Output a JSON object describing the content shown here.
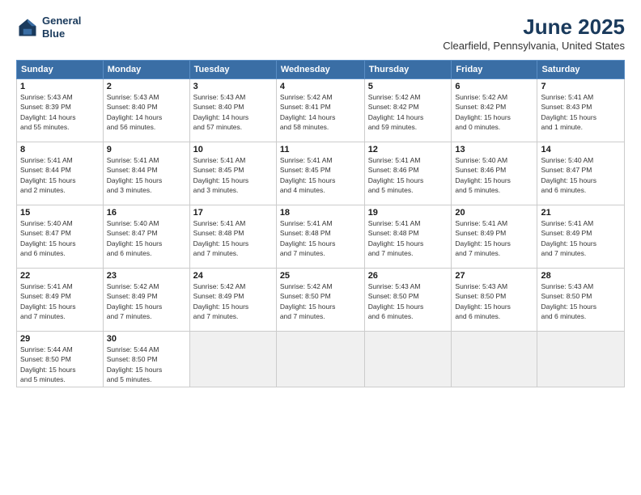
{
  "header": {
    "logo_line1": "General",
    "logo_line2": "Blue",
    "title": "June 2025",
    "subtitle": "Clearfield, Pennsylvania, United States"
  },
  "calendar": {
    "columns": [
      "Sunday",
      "Monday",
      "Tuesday",
      "Wednesday",
      "Thursday",
      "Friday",
      "Saturday"
    ],
    "weeks": [
      [
        {
          "day": "1",
          "info": "Sunrise: 5:43 AM\nSunset: 8:39 PM\nDaylight: 14 hours\nand 55 minutes."
        },
        {
          "day": "2",
          "info": "Sunrise: 5:43 AM\nSunset: 8:40 PM\nDaylight: 14 hours\nand 56 minutes."
        },
        {
          "day": "3",
          "info": "Sunrise: 5:43 AM\nSunset: 8:40 PM\nDaylight: 14 hours\nand 57 minutes."
        },
        {
          "day": "4",
          "info": "Sunrise: 5:42 AM\nSunset: 8:41 PM\nDaylight: 14 hours\nand 58 minutes."
        },
        {
          "day": "5",
          "info": "Sunrise: 5:42 AM\nSunset: 8:42 PM\nDaylight: 14 hours\nand 59 minutes."
        },
        {
          "day": "6",
          "info": "Sunrise: 5:42 AM\nSunset: 8:42 PM\nDaylight: 15 hours\nand 0 minutes."
        },
        {
          "day": "7",
          "info": "Sunrise: 5:41 AM\nSunset: 8:43 PM\nDaylight: 15 hours\nand 1 minute."
        }
      ],
      [
        {
          "day": "8",
          "info": "Sunrise: 5:41 AM\nSunset: 8:44 PM\nDaylight: 15 hours\nand 2 minutes."
        },
        {
          "day": "9",
          "info": "Sunrise: 5:41 AM\nSunset: 8:44 PM\nDaylight: 15 hours\nand 3 minutes."
        },
        {
          "day": "10",
          "info": "Sunrise: 5:41 AM\nSunset: 8:45 PM\nDaylight: 15 hours\nand 3 minutes."
        },
        {
          "day": "11",
          "info": "Sunrise: 5:41 AM\nSunset: 8:45 PM\nDaylight: 15 hours\nand 4 minutes."
        },
        {
          "day": "12",
          "info": "Sunrise: 5:41 AM\nSunset: 8:46 PM\nDaylight: 15 hours\nand 5 minutes."
        },
        {
          "day": "13",
          "info": "Sunrise: 5:40 AM\nSunset: 8:46 PM\nDaylight: 15 hours\nand 5 minutes."
        },
        {
          "day": "14",
          "info": "Sunrise: 5:40 AM\nSunset: 8:47 PM\nDaylight: 15 hours\nand 6 minutes."
        }
      ],
      [
        {
          "day": "15",
          "info": "Sunrise: 5:40 AM\nSunset: 8:47 PM\nDaylight: 15 hours\nand 6 minutes."
        },
        {
          "day": "16",
          "info": "Sunrise: 5:40 AM\nSunset: 8:47 PM\nDaylight: 15 hours\nand 6 minutes."
        },
        {
          "day": "17",
          "info": "Sunrise: 5:41 AM\nSunset: 8:48 PM\nDaylight: 15 hours\nand 7 minutes."
        },
        {
          "day": "18",
          "info": "Sunrise: 5:41 AM\nSunset: 8:48 PM\nDaylight: 15 hours\nand 7 minutes."
        },
        {
          "day": "19",
          "info": "Sunrise: 5:41 AM\nSunset: 8:48 PM\nDaylight: 15 hours\nand 7 minutes."
        },
        {
          "day": "20",
          "info": "Sunrise: 5:41 AM\nSunset: 8:49 PM\nDaylight: 15 hours\nand 7 minutes."
        },
        {
          "day": "21",
          "info": "Sunrise: 5:41 AM\nSunset: 8:49 PM\nDaylight: 15 hours\nand 7 minutes."
        }
      ],
      [
        {
          "day": "22",
          "info": "Sunrise: 5:41 AM\nSunset: 8:49 PM\nDaylight: 15 hours\nand 7 minutes."
        },
        {
          "day": "23",
          "info": "Sunrise: 5:42 AM\nSunset: 8:49 PM\nDaylight: 15 hours\nand 7 minutes."
        },
        {
          "day": "24",
          "info": "Sunrise: 5:42 AM\nSunset: 8:49 PM\nDaylight: 15 hours\nand 7 minutes."
        },
        {
          "day": "25",
          "info": "Sunrise: 5:42 AM\nSunset: 8:50 PM\nDaylight: 15 hours\nand 7 minutes."
        },
        {
          "day": "26",
          "info": "Sunrise: 5:43 AM\nSunset: 8:50 PM\nDaylight: 15 hours\nand 6 minutes."
        },
        {
          "day": "27",
          "info": "Sunrise: 5:43 AM\nSunset: 8:50 PM\nDaylight: 15 hours\nand 6 minutes."
        },
        {
          "day": "28",
          "info": "Sunrise: 5:43 AM\nSunset: 8:50 PM\nDaylight: 15 hours\nand 6 minutes."
        }
      ],
      [
        {
          "day": "29",
          "info": "Sunrise: 5:44 AM\nSunset: 8:50 PM\nDaylight: 15 hours\nand 5 minutes."
        },
        {
          "day": "30",
          "info": "Sunrise: 5:44 AM\nSunset: 8:50 PM\nDaylight: 15 hours\nand 5 minutes."
        },
        {
          "day": "",
          "info": ""
        },
        {
          "day": "",
          "info": ""
        },
        {
          "day": "",
          "info": ""
        },
        {
          "day": "",
          "info": ""
        },
        {
          "day": "",
          "info": ""
        }
      ]
    ]
  }
}
